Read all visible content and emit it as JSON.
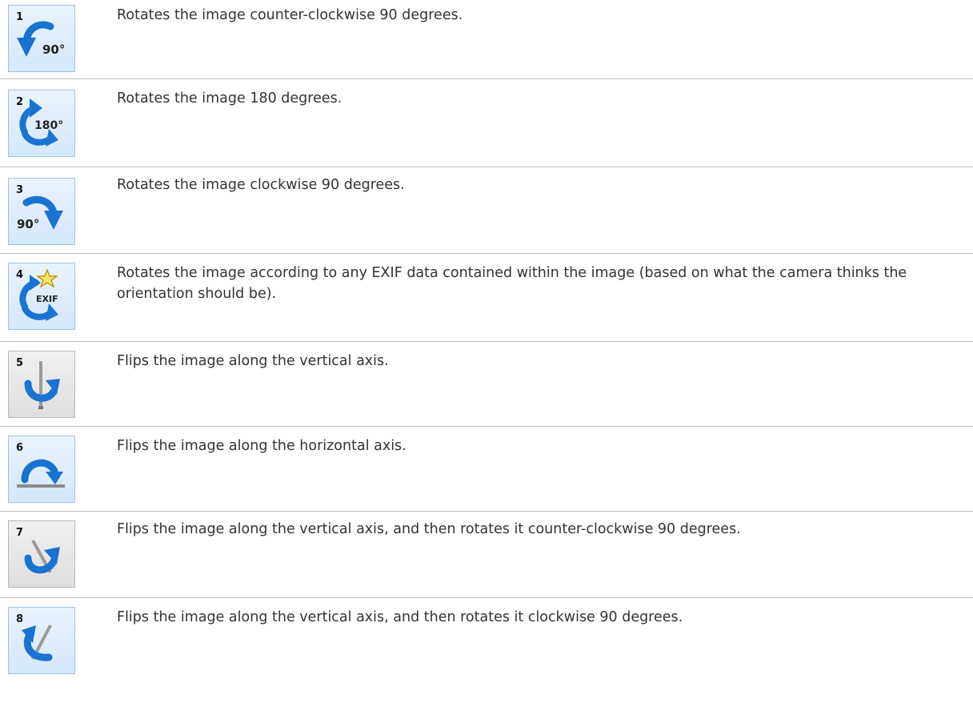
{
  "rows": [
    {
      "number": "1",
      "icon": "rotate-counter-clockwise-90-icon",
      "description": "Rotates the image counter-clockwise 90 degrees."
    },
    {
      "number": "2",
      "icon": "rotate-180-icon",
      "description": "Rotates the image 180 degrees."
    },
    {
      "number": "3",
      "icon": "rotate-clockwise-90-icon",
      "description": "Rotates the image clockwise 90 degrees."
    },
    {
      "number": "4",
      "icon": "rotate-exif-icon",
      "description": "Rotates the image according to any EXIF data contained within the image (based on what the camera thinks the orientation should be)."
    },
    {
      "number": "5",
      "icon": "flip-vertical-axis-icon",
      "description": "Flips the image along the vertical axis."
    },
    {
      "number": "6",
      "icon": "flip-horizontal-axis-icon",
      "description": "Flips the image along the horizontal axis."
    },
    {
      "number": "7",
      "icon": "flip-vertical-rotate-ccw-icon",
      "description": "Flips the image along the vertical axis, and then rotates it counter-clockwise 90 degrees."
    },
    {
      "number": "8",
      "icon": "flip-vertical-rotate-cw-icon",
      "description": "Flips the image along the vertical axis, and then rotates it clockwise 90 degrees."
    }
  ],
  "icon_labels": {
    "rotate_ccw": "90°",
    "rotate_180": "180°",
    "rotate_cw": "90°",
    "exif": "EXIF"
  },
  "colors": {
    "arrow_blue": "#1a73d1",
    "button_border": "#9dc2ec",
    "divider": "#bdbdbd"
  }
}
